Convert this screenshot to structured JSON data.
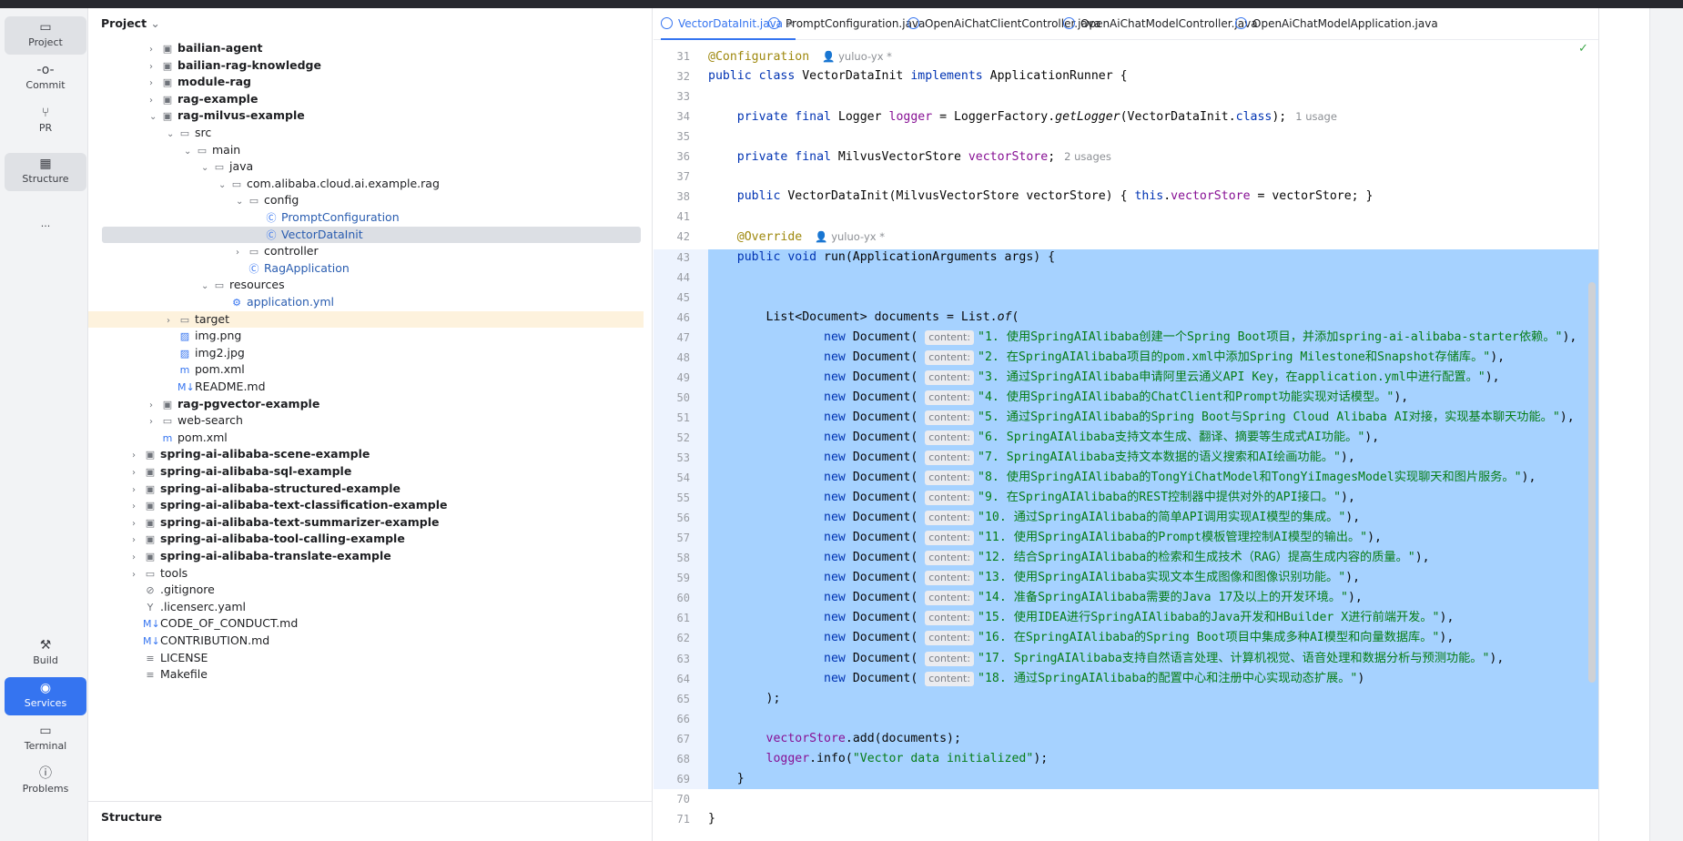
{
  "toolbar": {
    "items": [
      {
        "label": "Project",
        "icon": "folder-icon"
      },
      {
        "label": "Commit",
        "icon": "commit-icon"
      },
      {
        "label": "PR",
        "icon": "pull-request-icon"
      },
      {
        "label": "Structure",
        "icon": "structure-icon"
      },
      {
        "label": "...",
        "icon": "more-icon"
      },
      {
        "label": "Build",
        "icon": "hammer-icon"
      },
      {
        "label": "Services",
        "icon": "services-icon"
      },
      {
        "label": "Terminal",
        "icon": "terminal-icon"
      },
      {
        "label": "Problems",
        "icon": "problems-icon"
      }
    ]
  },
  "project": {
    "title": "Project",
    "tree": [
      {
        "label": "bailian-agent",
        "depth": 3,
        "kind": "module",
        "bold": true,
        "chev": "›"
      },
      {
        "label": "bailian-rag-knowledge",
        "depth": 3,
        "kind": "module",
        "bold": true,
        "chev": "›"
      },
      {
        "label": "module-rag",
        "depth": 3,
        "kind": "module",
        "bold": true,
        "chev": "›"
      },
      {
        "label": "rag-example",
        "depth": 3,
        "kind": "module",
        "bold": true,
        "chev": "›"
      },
      {
        "label": "rag-milvus-example",
        "depth": 3,
        "kind": "module",
        "bold": true,
        "chev": "⌄"
      },
      {
        "label": "src",
        "depth": 4,
        "kind": "folder",
        "chev": "⌄"
      },
      {
        "label": "main",
        "depth": 5,
        "kind": "folder",
        "chev": "⌄"
      },
      {
        "label": "java",
        "depth": 6,
        "kind": "folder",
        "chev": "⌄"
      },
      {
        "label": "com.alibaba.cloud.ai.example.rag",
        "depth": 7,
        "kind": "package",
        "chev": "⌄"
      },
      {
        "label": "config",
        "depth": 8,
        "kind": "package",
        "chev": "⌄"
      },
      {
        "label": "PromptConfiguration",
        "depth": 9,
        "kind": "class"
      },
      {
        "label": "VectorDataInit",
        "depth": 9,
        "kind": "class",
        "selected": true
      },
      {
        "label": "controller",
        "depth": 8,
        "kind": "package",
        "chev": "›"
      },
      {
        "label": "RagApplication",
        "depth": 8,
        "kind": "class"
      },
      {
        "label": "resources",
        "depth": 6,
        "kind": "folder",
        "chev": "⌄"
      },
      {
        "label": "application.yml",
        "depth": 7,
        "kind": "yml"
      },
      {
        "label": "target",
        "depth": 4,
        "kind": "folder",
        "chev": "›",
        "highlight": true
      },
      {
        "label": "img.png",
        "depth": 4,
        "kind": "image"
      },
      {
        "label": "img2.jpg",
        "depth": 4,
        "kind": "image"
      },
      {
        "label": "pom.xml",
        "depth": 4,
        "kind": "maven"
      },
      {
        "label": "README.md",
        "depth": 4,
        "kind": "md"
      },
      {
        "label": "rag-pgvector-example",
        "depth": 3,
        "kind": "module",
        "bold": true,
        "chev": "›"
      },
      {
        "label": "web-search",
        "depth": 3,
        "kind": "folder",
        "chev": "›"
      },
      {
        "label": "pom.xml",
        "depth": 3,
        "kind": "maven"
      },
      {
        "label": "spring-ai-alibaba-scene-example",
        "depth": 2,
        "kind": "module",
        "bold": true,
        "chev": "›"
      },
      {
        "label": "spring-ai-alibaba-sql-example",
        "depth": 2,
        "kind": "module",
        "bold": true,
        "chev": "›"
      },
      {
        "label": "spring-ai-alibaba-structured-example",
        "depth": 2,
        "kind": "module",
        "bold": true,
        "chev": "›"
      },
      {
        "label": "spring-ai-alibaba-text-classification-example",
        "depth": 2,
        "kind": "module",
        "bold": true,
        "chev": "›"
      },
      {
        "label": "spring-ai-alibaba-text-summarizer-example",
        "depth": 2,
        "kind": "module",
        "bold": true,
        "chev": "›"
      },
      {
        "label": "spring-ai-alibaba-tool-calling-example",
        "depth": 2,
        "kind": "module",
        "bold": true,
        "chev": "›"
      },
      {
        "label": "spring-ai-alibaba-translate-example",
        "depth": 2,
        "kind": "module",
        "bold": true,
        "chev": "›"
      },
      {
        "label": "tools",
        "depth": 2,
        "kind": "folder",
        "chev": "›"
      },
      {
        "label": ".gitignore",
        "depth": 2,
        "kind": "ignore"
      },
      {
        "label": ".licenserc.yaml",
        "depth": 2,
        "kind": "yaml"
      },
      {
        "label": "CODE_OF_CONDUCT.md",
        "depth": 2,
        "kind": "md"
      },
      {
        "label": "CONTRIBUTION.md",
        "depth": 2,
        "kind": "md"
      },
      {
        "label": "LICENSE",
        "depth": 2,
        "kind": "text"
      },
      {
        "label": "Makefile",
        "depth": 2,
        "kind": "text"
      }
    ],
    "structure_title": "Structure"
  },
  "editor": {
    "tabs": [
      {
        "label": "VectorDataInit.java",
        "active": true
      },
      {
        "label": "PromptConfiguration.java"
      },
      {
        "label": "OpenAiChatClientController.java"
      },
      {
        "label": "OpenAiChatModelController.java"
      },
      {
        "label": "OpenAiChatModelApplication.java"
      }
    ],
    "lines": [
      {
        "n": "31",
        "html": "<span class=\"an\">@Configuration</span><span class=\"author\">👤 yuluo-yx *</span>"
      },
      {
        "n": "32",
        "html": "<span class=\"kw\">public class</span> VectorDataInit <span class=\"kw\">implements</span> ApplicationRunner {"
      },
      {
        "n": "33",
        "html": ""
      },
      {
        "n": "34",
        "html": "    <span class=\"kw\">private final</span> Logger <span class=\"fld\">logger</span> = LoggerFactory.<span class=\"it\">getLogger</span>(VectorDataInit.<span class=\"kw\">class</span>);<span class=\"usage\">1 usage</span>"
      },
      {
        "n": "35",
        "html": ""
      },
      {
        "n": "36",
        "html": "    <span class=\"kw\">private final</span> MilvusVectorStore <span class=\"fld\">vectorStore</span>;<span class=\"usage\">2 usages</span>"
      },
      {
        "n": "37",
        "html": ""
      },
      {
        "n": "38",
        "html": "    <span class=\"kw\">public</span> VectorDataInit(MilvusVectorStore vectorStore) { <span class=\"kw\">this</span>.<span class=\"fld\">vectorStore</span> = vectorStore; }"
      },
      {
        "n": "41",
        "html": ""
      },
      {
        "n": "42",
        "html": "    <span class=\"an\">@Override</span><span class=\"author\">👤 yuluo-yx *</span>"
      },
      {
        "n": "43",
        "html": "    <span class=\"kw\">public void</span> run(ApplicationArguments args) {"
      },
      {
        "n": "44",
        "html": ""
      },
      {
        "n": "45",
        "html": ""
      },
      {
        "n": "46",
        "html": "        List&lt;Document&gt; documents = List.<span class=\"it\">of</span>("
      },
      {
        "n": "47",
        "html": "                <span class=\"kw\">new</span> Document( <span class=\"hint\">content:</span><span class=\"str\">\"1. 使用SpringAIAlibaba创建一个Spring Boot项目，并添加spring-ai-alibaba-starter依赖。\"</span>),"
      },
      {
        "n": "48",
        "html": "                <span class=\"kw\">new</span> Document( <span class=\"hint\">content:</span><span class=\"str\">\"2. 在SpringAIAlibaba项目的pom.xml中添加Spring Milestone和Snapshot存储库。\"</span>),"
      },
      {
        "n": "49",
        "html": "                <span class=\"kw\">new</span> Document( <span class=\"hint\">content:</span><span class=\"str\">\"3. 通过SpringAIAlibaba申请阿里云通义API Key，在application.yml中进行配置。\"</span>),"
      },
      {
        "n": "50",
        "html": "                <span class=\"kw\">new</span> Document( <span class=\"hint\">content:</span><span class=\"str\">\"4. 使用SpringAIAlibaba的ChatClient和Prompt功能实现对话模型。\"</span>),"
      },
      {
        "n": "51",
        "html": "                <span class=\"kw\">new</span> Document( <span class=\"hint\">content:</span><span class=\"str\">\"5. 通过SpringAIAlibaba的Spring Boot与Spring Cloud Alibaba AI对接，实现基本聊天功能。\"</span>),"
      },
      {
        "n": "52",
        "html": "                <span class=\"kw\">new</span> Document( <span class=\"hint\">content:</span><span class=\"str\">\"6. SpringAIAlibaba支持文本生成、翻译、摘要等生成式AI功能。\"</span>),"
      },
      {
        "n": "53",
        "html": "                <span class=\"kw\">new</span> Document( <span class=\"hint\">content:</span><span class=\"str\">\"7. SpringAIAlibaba支持文本数据的语义搜索和AI绘画功能。\"</span>),"
      },
      {
        "n": "54",
        "html": "                <span class=\"kw\">new</span> Document( <span class=\"hint\">content:</span><span class=\"str\">\"8. 使用SpringAIAlibaba的TongYiChatModel和TongYiImagesModel实现聊天和图片服务。\"</span>),"
      },
      {
        "n": "55",
        "html": "                <span class=\"kw\">new</span> Document( <span class=\"hint\">content:</span><span class=\"str\">\"9. 在SpringAIAlibaba的REST控制器中提供对外的API接口。\"</span>),"
      },
      {
        "n": "56",
        "html": "                <span class=\"kw\">new</span> Document( <span class=\"hint\">content:</span><span class=\"str\">\"10. 通过SpringAIAlibaba的简单API调用实现AI模型的集成。\"</span>),"
      },
      {
        "n": "57",
        "html": "                <span class=\"kw\">new</span> Document( <span class=\"hint\">content:</span><span class=\"str\">\"11. 使用SpringAIAlibaba的Prompt模板管理控制AI模型的输出。\"</span>),"
      },
      {
        "n": "58",
        "html": "                <span class=\"kw\">new</span> Document( <span class=\"hint\">content:</span><span class=\"str\">\"12. 结合SpringAIAlibaba的检索和生成技术（RAG）提高生成内容的质量。\"</span>),"
      },
      {
        "n": "59",
        "html": "                <span class=\"kw\">new</span> Document( <span class=\"hint\">content:</span><span class=\"str\">\"13. 使用SpringAIAlibaba实现文本生成图像和图像识别功能。\"</span>),"
      },
      {
        "n": "60",
        "html": "                <span class=\"kw\">new</span> Document( <span class=\"hint\">content:</span><span class=\"str\">\"14. 准备SpringAIAlibaba需要的Java 17及以上的开发环境。\"</span>),"
      },
      {
        "n": "61",
        "html": "                <span class=\"kw\">new</span> Document( <span class=\"hint\">content:</span><span class=\"str\">\"15. 使用IDEA进行SpringAIAlibaba的Java开发和HBuilder X进行前端开发。\"</span>),"
      },
      {
        "n": "62",
        "html": "                <span class=\"kw\">new</span> Document( <span class=\"hint\">content:</span><span class=\"str\">\"16. 在SpringAIAlibaba的Spring Boot项目中集成多种AI模型和向量数据库。\"</span>),"
      },
      {
        "n": "63",
        "html": "                <span class=\"kw\">new</span> Document( <span class=\"hint\">content:</span><span class=\"str\">\"17. SpringAIAlibaba支持自然语言处理、计算机视觉、语音处理和数据分析与预测功能。\"</span>),"
      },
      {
        "n": "64",
        "html": "                <span class=\"kw\">new</span> Document( <span class=\"hint\">content:</span><span class=\"str\">\"18. 通过SpringAIAlibaba的配置中心和注册中心实现动态扩展。\"</span>)"
      },
      {
        "n": "65",
        "html": "        );"
      },
      {
        "n": "66",
        "html": ""
      },
      {
        "n": "67",
        "html": "        <span class=\"fld\">vectorStore</span>.add(documents);"
      },
      {
        "n": "68",
        "html": "        <span class=\"fld\">logger</span>.info(<span class=\"str\">\"Vector data initialized\"</span>);"
      },
      {
        "n": "69",
        "html": "    }"
      },
      {
        "n": "70",
        "html": ""
      },
      {
        "n": "71",
        "html": "}"
      }
    ]
  },
  "colors": {
    "accent": "#3574f0",
    "selection": "#a6d2ff",
    "keyword": "#0033b3",
    "string": "#067d17",
    "field": "#871094",
    "annotation": "#9e880d"
  }
}
